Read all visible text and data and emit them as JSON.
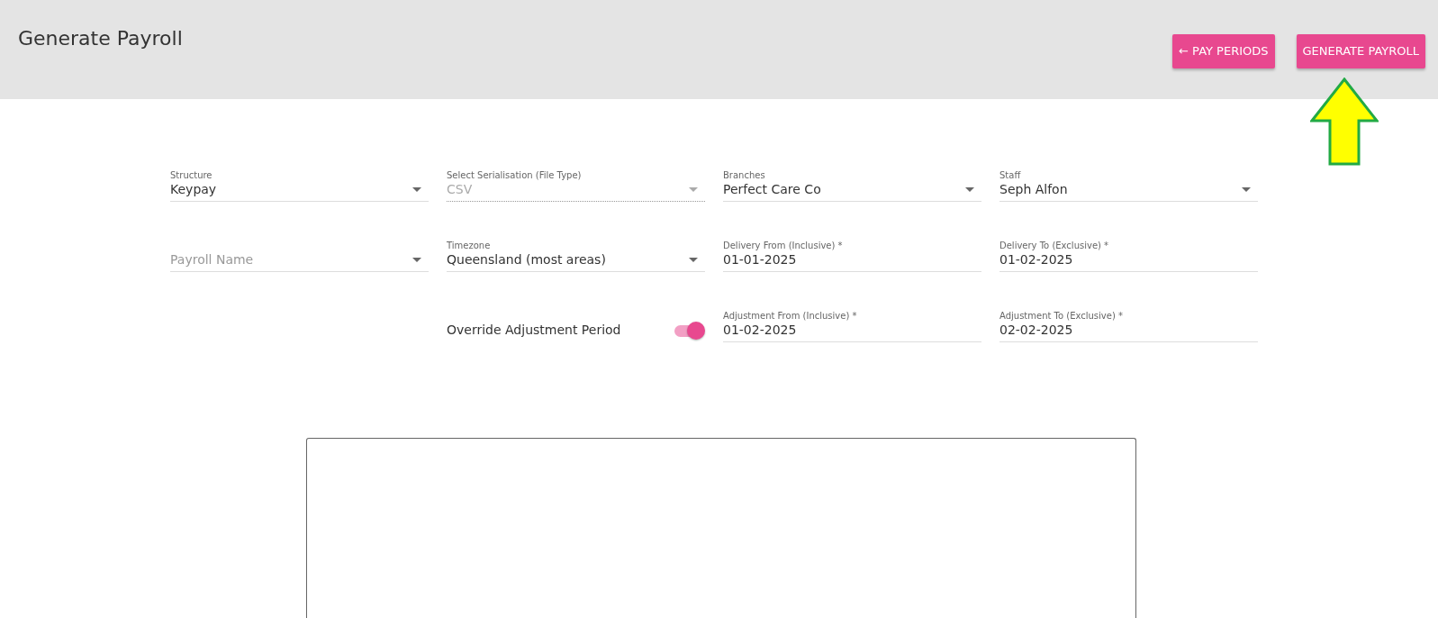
{
  "header": {
    "title": "Generate Payroll",
    "buttons": [
      {
        "label": "← PAY PERIODS"
      },
      {
        "label": "GENERATE PAYROLL"
      }
    ]
  },
  "form_rows": [
    [
      {
        "kind": "select",
        "label": "Structure",
        "value": "Keypay",
        "disabled": false
      },
      {
        "kind": "select",
        "label": "Select Serialisation (File Type)",
        "value": "CSV",
        "disabled": true
      },
      {
        "kind": "select",
        "label": "Branches",
        "value": "Perfect Care Co",
        "disabled": false
      },
      {
        "kind": "select",
        "label": "Staff",
        "value": "Seph Alfon",
        "disabled": false
      }
    ],
    [
      {
        "kind": "select",
        "placeholder": "Payroll Name",
        "disabled": false
      },
      {
        "kind": "select",
        "label": "Timezone",
        "value": "Queensland (most areas)",
        "disabled": false
      },
      {
        "kind": "date",
        "label": "Delivery From (Inclusive) *",
        "value": "01-01-2025"
      },
      {
        "kind": "date",
        "label": "Delivery To (Exclusive) *",
        "value": "01-02-2025"
      }
    ],
    [
      {
        "kind": "blank"
      },
      {
        "kind": "toggle",
        "label": "Override Adjustment Period",
        "on": true
      },
      {
        "kind": "date",
        "label": "Adjustment From (Inclusive) *",
        "value": "01-02-2025"
      },
      {
        "kind": "date",
        "label": "Adjustment To (Exclusive) *",
        "value": "02-02-2025"
      }
    ]
  ]
}
